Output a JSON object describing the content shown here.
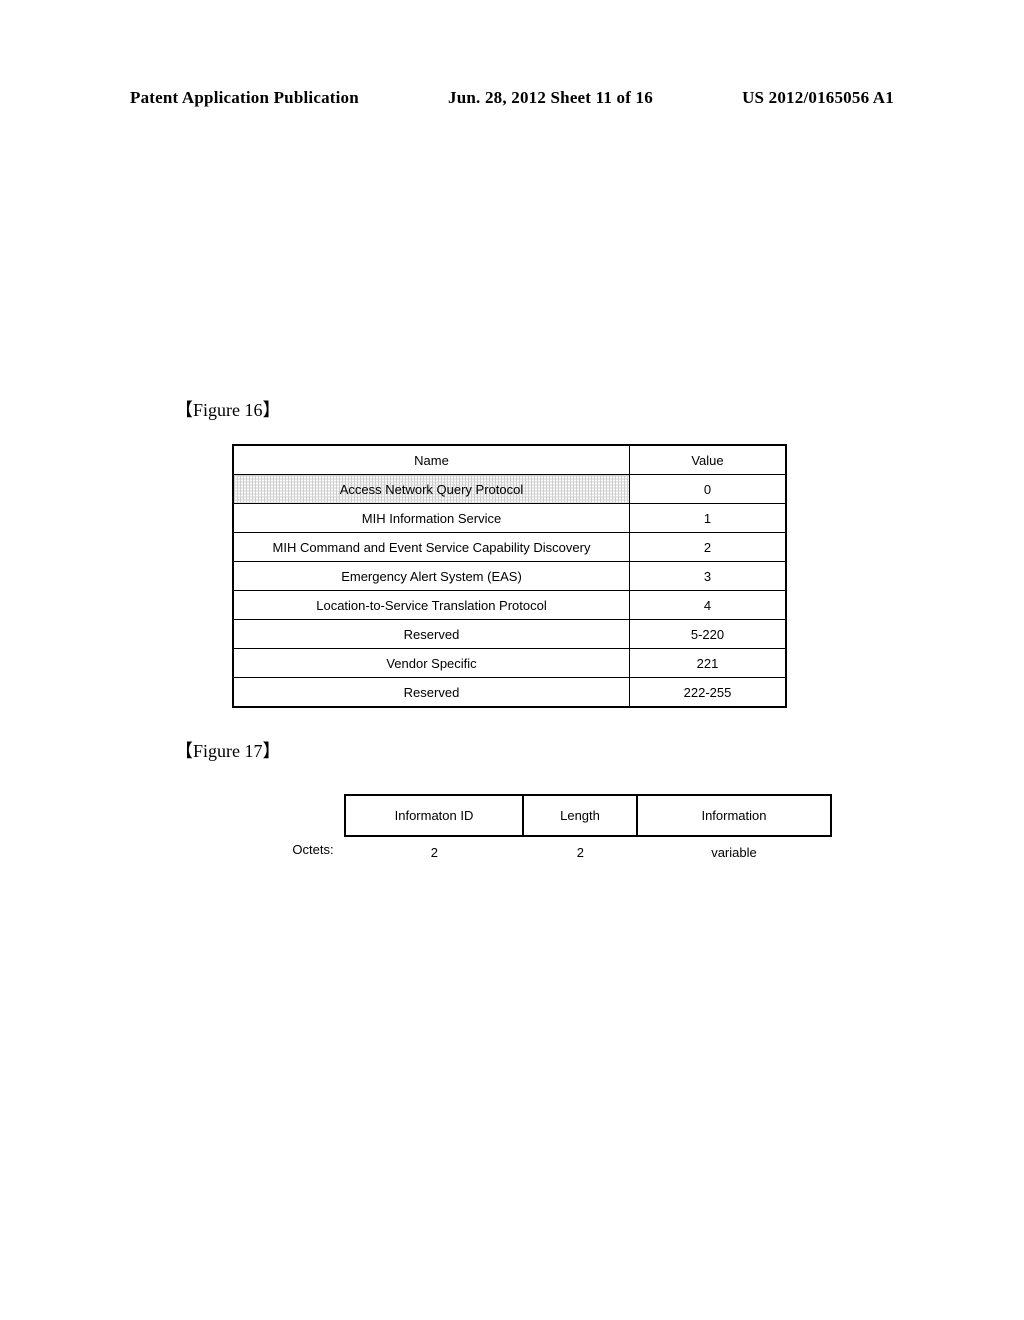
{
  "header": {
    "left": "Patent Application Publication",
    "center": "Jun. 28, 2012  Sheet 11 of 16",
    "right": "US 2012/0165056 A1"
  },
  "fig16": {
    "label": "【Figure 16】",
    "headers": {
      "name": "Name",
      "value": "Value"
    },
    "rows": [
      {
        "name": "Access Network Query Protocol",
        "value": "0",
        "hatched": true
      },
      {
        "name": "MIH Information Service",
        "value": "1",
        "hatched": false
      },
      {
        "name": "MIH Command and Event Service Capability Discovery",
        "value": "2",
        "hatched": false
      },
      {
        "name": "Emergency Alert System (EAS)",
        "value": "3",
        "hatched": false
      },
      {
        "name": "Location-to-Service Translation Protocol",
        "value": "4",
        "hatched": false
      },
      {
        "name": "Reserved",
        "value": "5-220",
        "hatched": false
      },
      {
        "name": "Vendor Specific",
        "value": "221",
        "hatched": false
      },
      {
        "name": "Reserved",
        "value": "222-255",
        "hatched": false
      }
    ]
  },
  "fig17": {
    "label": "【Figure 17】",
    "cols": [
      {
        "header": "Informaton ID",
        "octets": "2"
      },
      {
        "header": "Length",
        "octets": "2"
      },
      {
        "header": "Information",
        "octets": "variable"
      }
    ],
    "octets_label": "Octets:"
  }
}
